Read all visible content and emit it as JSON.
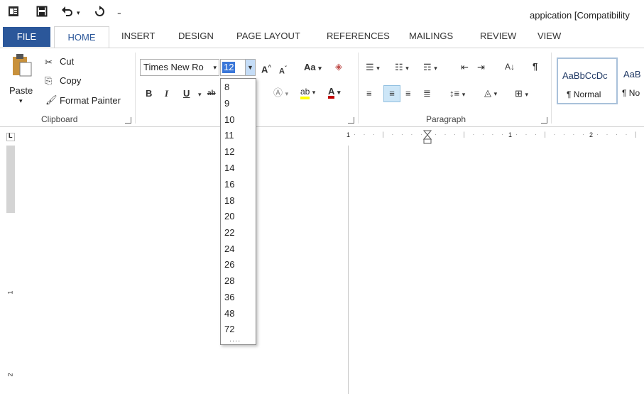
{
  "window": {
    "title": "appication [Compatibility"
  },
  "quick_access": {
    "word_icon": "word-app-icon",
    "save_icon": "save-icon",
    "undo_icon": "undo-icon",
    "redo_icon": "redo-icon",
    "customize_icon": "customize-qat-icon"
  },
  "tabs": [
    {
      "label": "FILE"
    },
    {
      "label": "HOME"
    },
    {
      "label": "INSERT"
    },
    {
      "label": "DESIGN"
    },
    {
      "label": "PAGE LAYOUT"
    },
    {
      "label": "REFERENCES"
    },
    {
      "label": "MAILINGS"
    },
    {
      "label": "REVIEW"
    },
    {
      "label": "VIEW"
    }
  ],
  "clipboard": {
    "paste_label": "Paste",
    "cut_label": "Cut",
    "copy_label": "Copy",
    "format_painter_label": "Format Painter",
    "group_label": "Clipboard"
  },
  "font": {
    "name": "Times New Ro",
    "size": "12",
    "bold": "B",
    "italic": "I",
    "underline": "U",
    "change_case": "Aa"
  },
  "paragraph": {
    "group_label": "Paragraph"
  },
  "styles": [
    {
      "sample": "AaBbCcDc",
      "name": "¶ Normal"
    },
    {
      "sample": "AaB",
      "name": "¶ No"
    }
  ],
  "font_size_options": [
    "8",
    "9",
    "10",
    "11",
    "12",
    "14",
    "16",
    "18",
    "20",
    "22",
    "24",
    "26",
    "28",
    "36",
    "48",
    "72"
  ],
  "dropdown_more": "....",
  "ruler": {
    "h_marks": [
      "1",
      "1",
      "2"
    ],
    "v_marks": [
      "1",
      "2"
    ]
  },
  "colors": {
    "file_tab": "#2b579a",
    "highlight": "#3a77d9",
    "font_color_bar": "#c00000",
    "highlight_bar": "#ffff00"
  }
}
